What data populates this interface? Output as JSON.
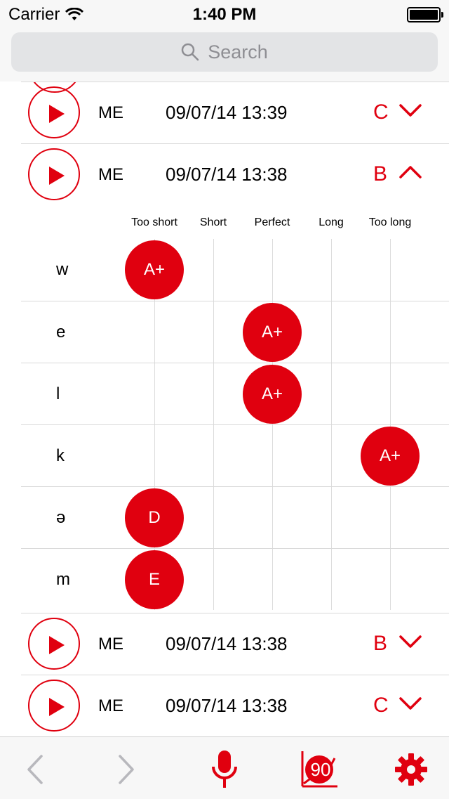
{
  "status_bar": {
    "carrier": "Carrier",
    "time": "1:40 PM"
  },
  "search": {
    "placeholder": "Search"
  },
  "recordings": [
    {
      "speaker": "ME",
      "datetime": "09/07/14 13:39",
      "grade": "C",
      "expanded": false
    },
    {
      "speaker": "ME",
      "datetime": "09/07/14 13:38",
      "grade": "B",
      "expanded": true
    },
    {
      "speaker": "ME",
      "datetime": "09/07/14 13:38",
      "grade": "B",
      "expanded": false
    },
    {
      "speaker": "ME",
      "datetime": "09/07/14 13:38",
      "grade": "C",
      "expanded": false
    }
  ],
  "duration_columns": [
    "Too short",
    "Short",
    "Perfect",
    "Long",
    "Too long"
  ],
  "phonemes": [
    {
      "symbol": "w",
      "duration": "Too short",
      "grade": "A+"
    },
    {
      "symbol": "e",
      "duration": "Perfect",
      "grade": "A+"
    },
    {
      "symbol": "l",
      "duration": "Perfect",
      "grade": "A+"
    },
    {
      "symbol": "k",
      "duration": "Too long",
      "grade": "A+"
    },
    {
      "symbol": "ə",
      "duration": "Too short",
      "grade": "D"
    },
    {
      "symbol": "m",
      "duration": "Too short",
      "grade": "E"
    }
  ],
  "toolbar": {
    "score_badge": "90",
    "icons": [
      "back-arrow-icon",
      "forward-arrow-icon",
      "microphone-icon",
      "score-chart-icon",
      "gear-icon"
    ]
  },
  "colors": {
    "accent": "#e0000f",
    "bar_background": "#f7f7f7",
    "disabled": "#b8b8bd"
  }
}
